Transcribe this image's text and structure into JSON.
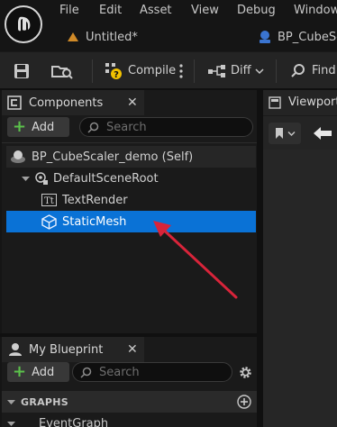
{
  "menu": {
    "items": [
      "File",
      "Edit",
      "Asset",
      "View",
      "Debug",
      "Window"
    ]
  },
  "tabs": {
    "untitled": "Untitled*",
    "blueprint": "BP_CubeSc"
  },
  "toolbar": {
    "compile": "Compile",
    "diff": "Diff",
    "find": "Find"
  },
  "components": {
    "title": "Components",
    "add_label": "Add",
    "search_placeholder": "Search",
    "tree": [
      {
        "label": "BP_CubeScaler_demo (Self)"
      },
      {
        "label": "DefaultSceneRoot"
      },
      {
        "label": "TextRender"
      },
      {
        "label": "StaticMesh"
      }
    ]
  },
  "viewport": {
    "title": "Viewport"
  },
  "my_blueprint": {
    "title": "My Blueprint",
    "add_label": "Add",
    "search_placeholder": "Search",
    "graphs_label": "GRAPHS",
    "event_graph": "EventGraph"
  },
  "colors": {
    "selection": "#0a72d6",
    "add_plus": "#5bc24b",
    "annotation_arrow": "#d8243a",
    "compile_badge": "#f2c200"
  }
}
